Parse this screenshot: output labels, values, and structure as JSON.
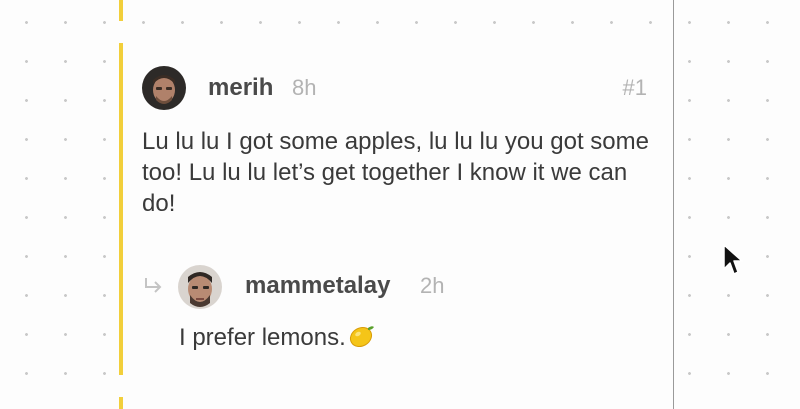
{
  "post": {
    "author": "merih",
    "time": "8h",
    "number": "#1",
    "avatar_icon": "user-avatar-photo",
    "text": "Lu lu lu I got some apples, lu lu lu you got some too! Lu lu lu let’s get together I know it we can do!"
  },
  "reply": {
    "author": "mammetalay",
    "time": "2h",
    "avatar_icon": "user-avatar-photo",
    "reply_icon": "reply-arrow-icon",
    "text": "I prefer lemons.",
    "emoji": "lemon-emoji"
  },
  "colors": {
    "accent_bar": "#f2cf3b",
    "username": "#4a4a4a",
    "muted": "#b3b3b3",
    "body": "#3a3a3a"
  }
}
